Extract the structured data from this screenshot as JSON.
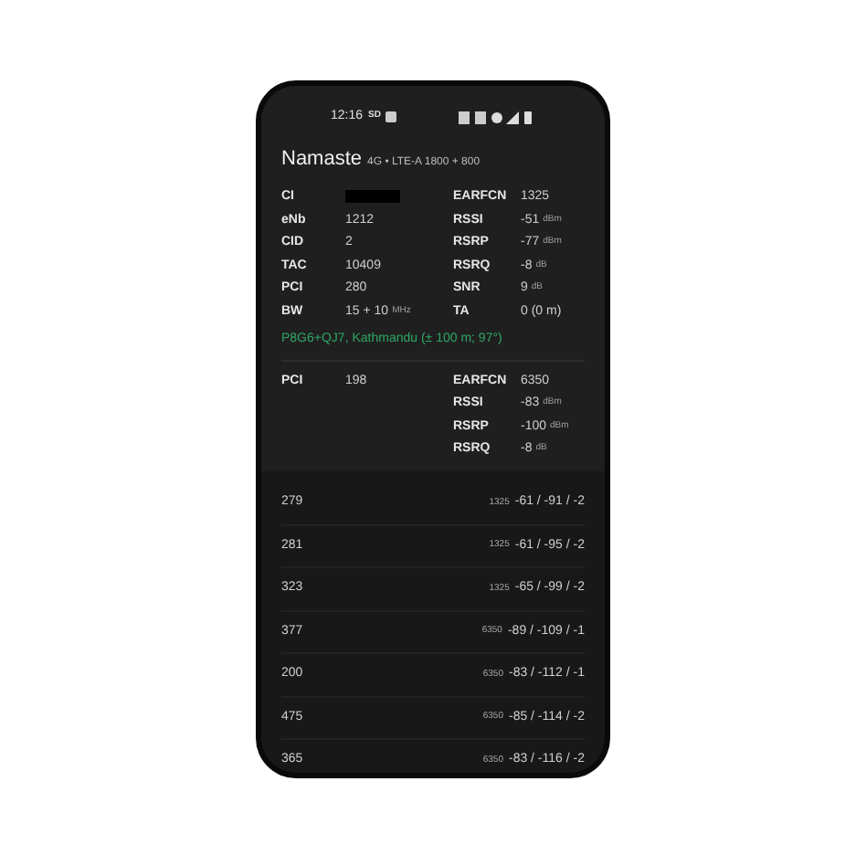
{
  "status_bar": {
    "time": "12:16",
    "sd": "SD"
  },
  "header": {
    "name": "Namaste",
    "tech": "4G • LTE-A 1800 + 800"
  },
  "serving": {
    "rows": [
      {
        "k1": "CI",
        "v1": "",
        "redacted": true,
        "k2": "EARFCN",
        "v2": "1325",
        "u2": ""
      },
      {
        "k1": "eNb",
        "v1": "1212",
        "u1": "",
        "k2": "RSSI",
        "v2": "-51",
        "u2": "dBm"
      },
      {
        "k1": "CID",
        "v1": "2",
        "u1": "",
        "k2": "RSRP",
        "v2": "-77",
        "u2": "dBm"
      },
      {
        "k1": "TAC",
        "v1": "10409",
        "u1": "",
        "k2": "RSRQ",
        "v2": "-8",
        "u2": "dB"
      },
      {
        "k1": "PCI",
        "v1": "280",
        "u1": "",
        "k2": "SNR",
        "v2": "9",
        "u2": "dB"
      },
      {
        "k1": "BW",
        "v1": "15 + 10",
        "u1": "MHz",
        "k2": "TA",
        "v2": "0 (0 m)",
        "u2": ""
      }
    ],
    "location": "P8G6+QJ7, Kathmandu (± 100 m; 97°)"
  },
  "secondary": {
    "rows": [
      {
        "k1": "PCI",
        "v1": "198",
        "k2": "EARFCN",
        "v2": "6350",
        "u2": ""
      },
      {
        "k1": "",
        "v1": "",
        "k2": "RSSI",
        "v2": "-83",
        "u2": "dBm"
      },
      {
        "k1": "",
        "v1": "",
        "k2": "RSRP",
        "v2": "-100",
        "u2": "dBm"
      },
      {
        "k1": "",
        "v1": "",
        "k2": "RSRQ",
        "v2": "-8",
        "u2": "dB"
      }
    ]
  },
  "neighbors": [
    {
      "pci": "279",
      "earfcn": "1325",
      "reading": "-61 / -91 / -2"
    },
    {
      "pci": "281",
      "earfcn": "1325",
      "reading": "-61 / -95 / -2"
    },
    {
      "pci": "323",
      "earfcn": "1325",
      "reading": "-65 / -99 / -2"
    },
    {
      "pci": "377",
      "earfcn": "6350",
      "reading": "-89 / -109 / -1"
    },
    {
      "pci": "200",
      "earfcn": "6350",
      "reading": "-83 / -112 / -1"
    },
    {
      "pci": "475",
      "earfcn": "6350",
      "reading": "-85 / -114 / -2"
    },
    {
      "pci": "365",
      "earfcn": "6350",
      "reading": "-83 / -116 / -2"
    }
  ]
}
